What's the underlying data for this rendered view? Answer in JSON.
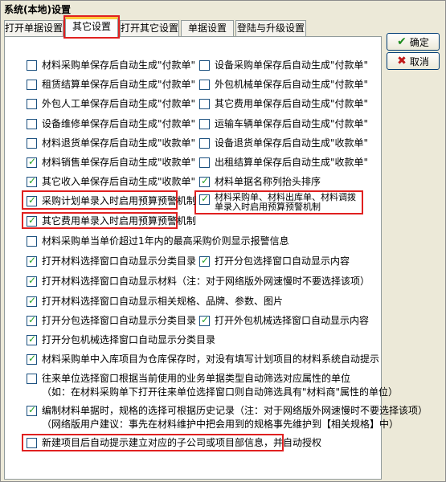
{
  "window": {
    "title": "系统(本地)设置"
  },
  "tabs": [
    {
      "label": "打开单据设置"
    },
    {
      "label": "其它设置"
    },
    {
      "label": "打开其它设置"
    },
    {
      "label": "单据设置"
    },
    {
      "label": "登陆与升级设置"
    }
  ],
  "buttons": {
    "ok": "确定",
    "cancel": "取消"
  },
  "options": {
    "o1": {
      "label": "材料采购单保存后自动生成\"付款单\"",
      "checked": false
    },
    "o2": {
      "label": "设备采购单保存后自动生成\"付款单\"",
      "checked": false
    },
    "o3": {
      "label": "租赁结算单保存后自动生成\"付款单\"",
      "checked": false
    },
    "o4": {
      "label": "外包机械单保存后自动生成\"付款单\"",
      "checked": false
    },
    "o5": {
      "label": "外包人工单保存后自动生成\"付款单\"",
      "checked": false
    },
    "o6": {
      "label": "其它费用单保存后自动生成\"付款单\"",
      "checked": false
    },
    "o7": {
      "label": "设备维修单保存后自动生成\"付款单\"",
      "checked": false
    },
    "o8": {
      "label": "运输车辆单保存后自动生成\"付款单\"",
      "checked": false
    },
    "o9": {
      "label": "材料退货单保存后自动生成\"收款单\"",
      "checked": false
    },
    "o10": {
      "label": "设备退货单保存后自动生成\"收款单\"",
      "checked": false
    },
    "o11": {
      "label": "材料销售单保存后自动生成\"收款单\"",
      "checked": true
    },
    "o12": {
      "label": "出租结算单保存后自动生成\"收款单\"",
      "checked": false
    },
    "o13": {
      "label": "其它收入单保存后自动生成\"收款单\"",
      "checked": true
    },
    "o14": {
      "label": "材料单据名称列抬头排序",
      "checked": true
    },
    "o15": {
      "label": "采购计划单录入时启用预算预警机制",
      "checked": true
    },
    "o16": {
      "label": "材料采购单、材料出库单、材料调拨单录入时启用预算预警机制",
      "checked": true
    },
    "o17": {
      "label": "其它费用单录入时启用预算预警机制",
      "checked": true
    },
    "o18": {
      "label": "材料采购单当单价超过1年内的最高采购价则显示报警信息",
      "checked": false
    },
    "o19": {
      "label": "打开材料选择窗口自动显示分类目录",
      "checked": true
    },
    "o20": {
      "label": "打开分包选择窗口自动显示内容",
      "checked": true
    },
    "o21": {
      "label": "打开材料选择窗口自动显示材料（注：对于网络版外网速慢时不要选择该项）",
      "checked": true
    },
    "o22": {
      "label": "打开材料选择窗口自动显示相关规格、品牌、参数、图片",
      "checked": true
    },
    "o23": {
      "label": "打开分包选择窗口自动显示分类目录",
      "checked": true
    },
    "o24": {
      "label": "打开外包机械选择窗口自动显示内容",
      "checked": true
    },
    "o25": {
      "label": "打开分包机械选择窗口自动显示分类目录",
      "checked": true
    },
    "o26": {
      "label": "材料采购单中入库项目为仓库保存时，对没有填写计划项目的材料系统自动提示",
      "checked": true
    },
    "o27": {
      "label": "往来单位选择窗口根据当前使用的业务单据类型自动筛选对应属性的单位",
      "note": "（如：在材料采购单下打开往来单位选择窗口则自动筛选具有\"材料商\"属性的单位）",
      "checked": false
    },
    "o28": {
      "label": "编制材料单据时，规格的选择可根据历史记录（注：对于网络版外网速慢时不要选择该项）",
      "note": "（网络版用户建议：事先在材料维护中把会用到的规格事先维护到【相关规格】中）",
      "checked": true
    },
    "o29": {
      "label": "新建项目后自动提示建立对应的子公司或项目部信息，并自动授权",
      "checked": false
    }
  }
}
